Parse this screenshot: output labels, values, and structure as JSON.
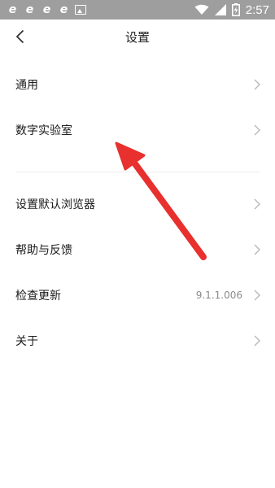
{
  "status_bar": {
    "time": "2:57",
    "left_icons": [
      "browser-e-icon",
      "browser-e-icon",
      "browser-e-icon",
      "browser-e-icon",
      "image-icon"
    ],
    "right_icons": [
      "wifi-icon",
      "signal-icon",
      "battery-charging-icon"
    ],
    "background": "#9e9e9e"
  },
  "header": {
    "title": "设置",
    "back_icon": "chevron-left-icon"
  },
  "menu": {
    "group1": [
      {
        "label": "通用"
      },
      {
        "label": "数字实验室"
      }
    ],
    "group2": [
      {
        "label": "设置默认浏览器"
      },
      {
        "label": "帮助与反馈"
      },
      {
        "label": "检查更新",
        "value": "9.1.1.006"
      },
      {
        "label": "关于"
      }
    ]
  },
  "annotation": {
    "arrow_color": "#e8302e",
    "icon": "red-arrow-icon"
  }
}
